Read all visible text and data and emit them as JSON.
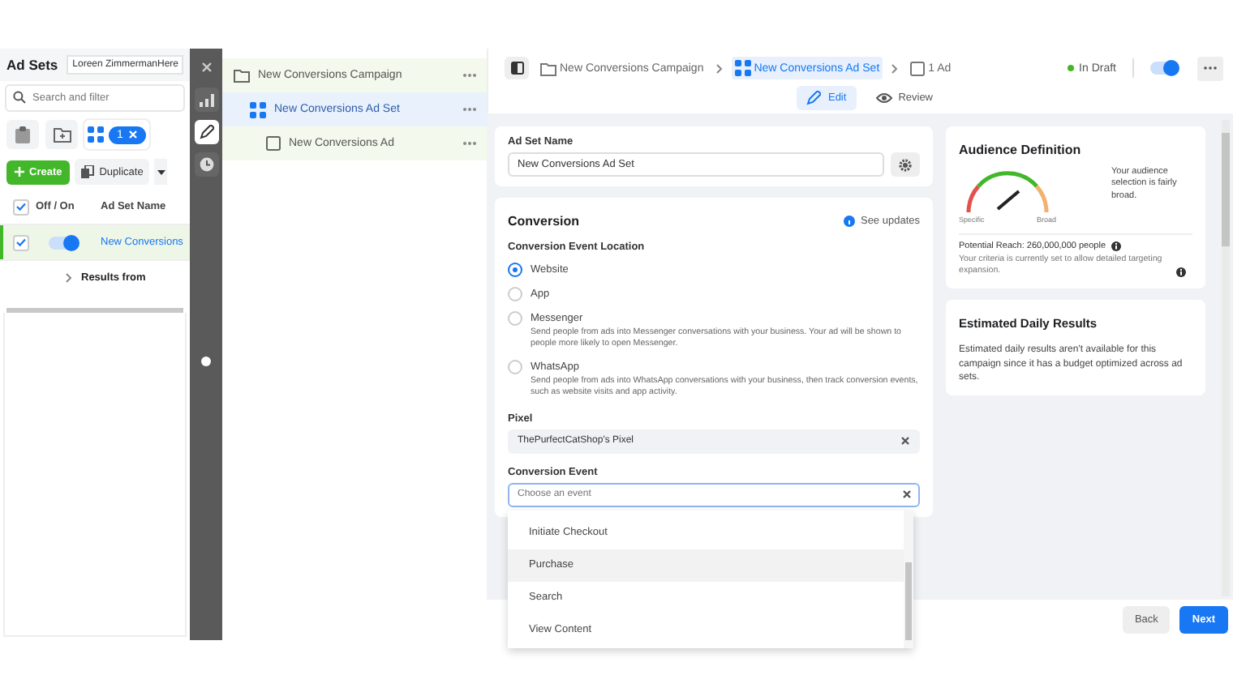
{
  "ad_sets_panel": {
    "title": "Ad Sets",
    "account": "Loreen ZimmermanHere",
    "search": {
      "placeholder": "Search and filter"
    },
    "views": [
      {
        "kind": "clipboard",
        "selected": false
      },
      {
        "kind": "folder",
        "selected": false
      },
      {
        "kind": "grid",
        "selected": true,
        "badge": "1"
      }
    ],
    "create": "Create",
    "duplicate": "Duplicate",
    "select_all_checked": true,
    "columns": [
      "Off / On",
      "Ad Set Name"
    ],
    "rows": [
      {
        "checked": true,
        "on": true,
        "selected": true,
        "name": "New Conversions"
      }
    ],
    "results_row": "Results from"
  },
  "tools": [
    {
      "kind": "chart",
      "selected": false
    },
    {
      "kind": "edit",
      "selected": true
    },
    {
      "kind": "history",
      "selected": false
    }
  ],
  "tree": [
    {
      "kind": "campaign",
      "label": "New Conversions Campaign",
      "selected": false,
      "children": [
        {
          "kind": "ad_set",
          "label": "New Conversions Ad Set",
          "selected": true,
          "children": [
            {
              "kind": "ad",
              "label": "New Conversions Ad",
              "selected": false
            }
          ]
        }
      ]
    }
  ],
  "header": {
    "breadcrumbs": [
      {
        "kind": "campaign",
        "label": "New Conversions Campaign",
        "selected": false
      },
      {
        "kind": "ad_set",
        "label": "New Conversions Ad Set",
        "selected": true
      },
      {
        "kind": "ad",
        "label": "1 Ad",
        "selected": false
      }
    ],
    "status": "In Draft",
    "published_on": true,
    "tabs": [
      {
        "kind": "edit",
        "label": "Edit",
        "selected": true
      },
      {
        "kind": "review",
        "label": "Review",
        "selected": false
      }
    ]
  },
  "ad_set_name": {
    "label": "Ad Set Name",
    "value": "New Conversions Ad Set"
  },
  "conversion": {
    "title": "Conversion",
    "updates_link": "See updates",
    "location_label": "Conversion Event Location",
    "locations": [
      {
        "label": "Website",
        "selected": true
      },
      {
        "label": "App",
        "selected": false
      },
      {
        "label": "Messenger",
        "description": "Send people from ads into Messenger conversations with your business. Your ad will be shown to people more likely to open Messenger.",
        "selected": false
      },
      {
        "label": "WhatsApp",
        "description": "Send people from ads into WhatsApp conversations with your business, then track conversion events, such as website visits and app activity.",
        "selected": false
      }
    ],
    "pixel": {
      "label": "Pixel",
      "value": "ThePurfectCatShop's Pixel"
    },
    "conversion_event": {
      "label": "Conversion Event",
      "placeholder": "Choose an event",
      "options": [
        {
          "label": "Initiate Checkout",
          "selected": false
        },
        {
          "label": "Purchase",
          "selected": true
        },
        {
          "label": "Search",
          "selected": false
        },
        {
          "label": "View Content",
          "selected": false
        }
      ]
    }
  },
  "audience": {
    "title": "Audience Definition",
    "gauge_low": "Specific",
    "gauge_high": "Broad",
    "summary": "Your audience selection is fairly broad.",
    "reach": "Potential Reach: 260,000,000 people",
    "criteria": "Your criteria is currently set to allow detailed targeting expansion."
  },
  "estimate": {
    "title": "Estimated Daily Results",
    "text": "Estimated daily results aren't available for this campaign since it has a budget optimized across ad sets."
  },
  "footer": {
    "back": "Back",
    "next": "Next"
  }
}
